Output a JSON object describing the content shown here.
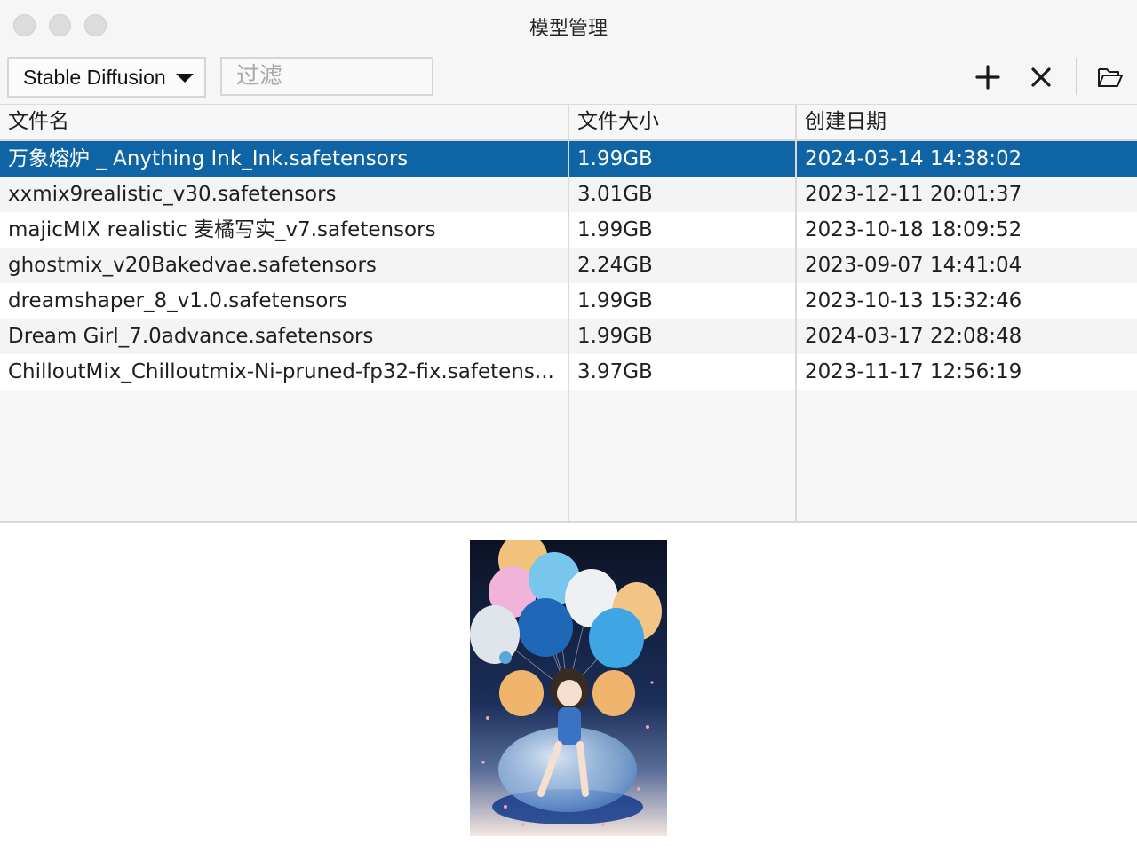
{
  "window": {
    "title": "模型管理"
  },
  "toolbar": {
    "model_type": "Stable Diffusion",
    "filter_placeholder": "过滤",
    "filter_value": ""
  },
  "table": {
    "columns": [
      "文件名",
      "文件大小",
      "创建日期"
    ],
    "rows": [
      {
        "name": "万象熔炉 _ Anything Ink_Ink.safetensors",
        "size": "1.99GB",
        "date": "2024-03-14 14:38:02",
        "selected": true
      },
      {
        "name": "xxmix9realistic_v30.safetensors",
        "size": "3.01GB",
        "date": "2023-12-11 20:01:37"
      },
      {
        "name": "majicMIX realistic 麦橘写实_v7.safetensors",
        "size": "1.99GB",
        "date": "2023-10-18 18:09:52"
      },
      {
        "name": "ghostmix_v20Bakedvae.safetensors",
        "size": "2.24GB",
        "date": "2023-09-07 14:41:04"
      },
      {
        "name": "dreamshaper_8_v1.0.safetensors",
        "size": "1.99GB",
        "date": "2023-10-13 15:32:46"
      },
      {
        "name": "Dream Girl_7.0advance.safetensors",
        "size": "1.99GB",
        "date": "2024-03-17 22:08:48"
      },
      {
        "name": "ChilloutMix_Chilloutmix-Ni-pruned-fp32-fix.safetens...",
        "size": "3.97GB",
        "date": "2023-11-17 12:56:19"
      }
    ]
  },
  "colors": {
    "selection": "#0e64a4",
    "header_bg": "#f6f6f6"
  },
  "icons": {
    "add": "plus-icon",
    "delete": "close-icon",
    "open": "folder-open-icon"
  }
}
